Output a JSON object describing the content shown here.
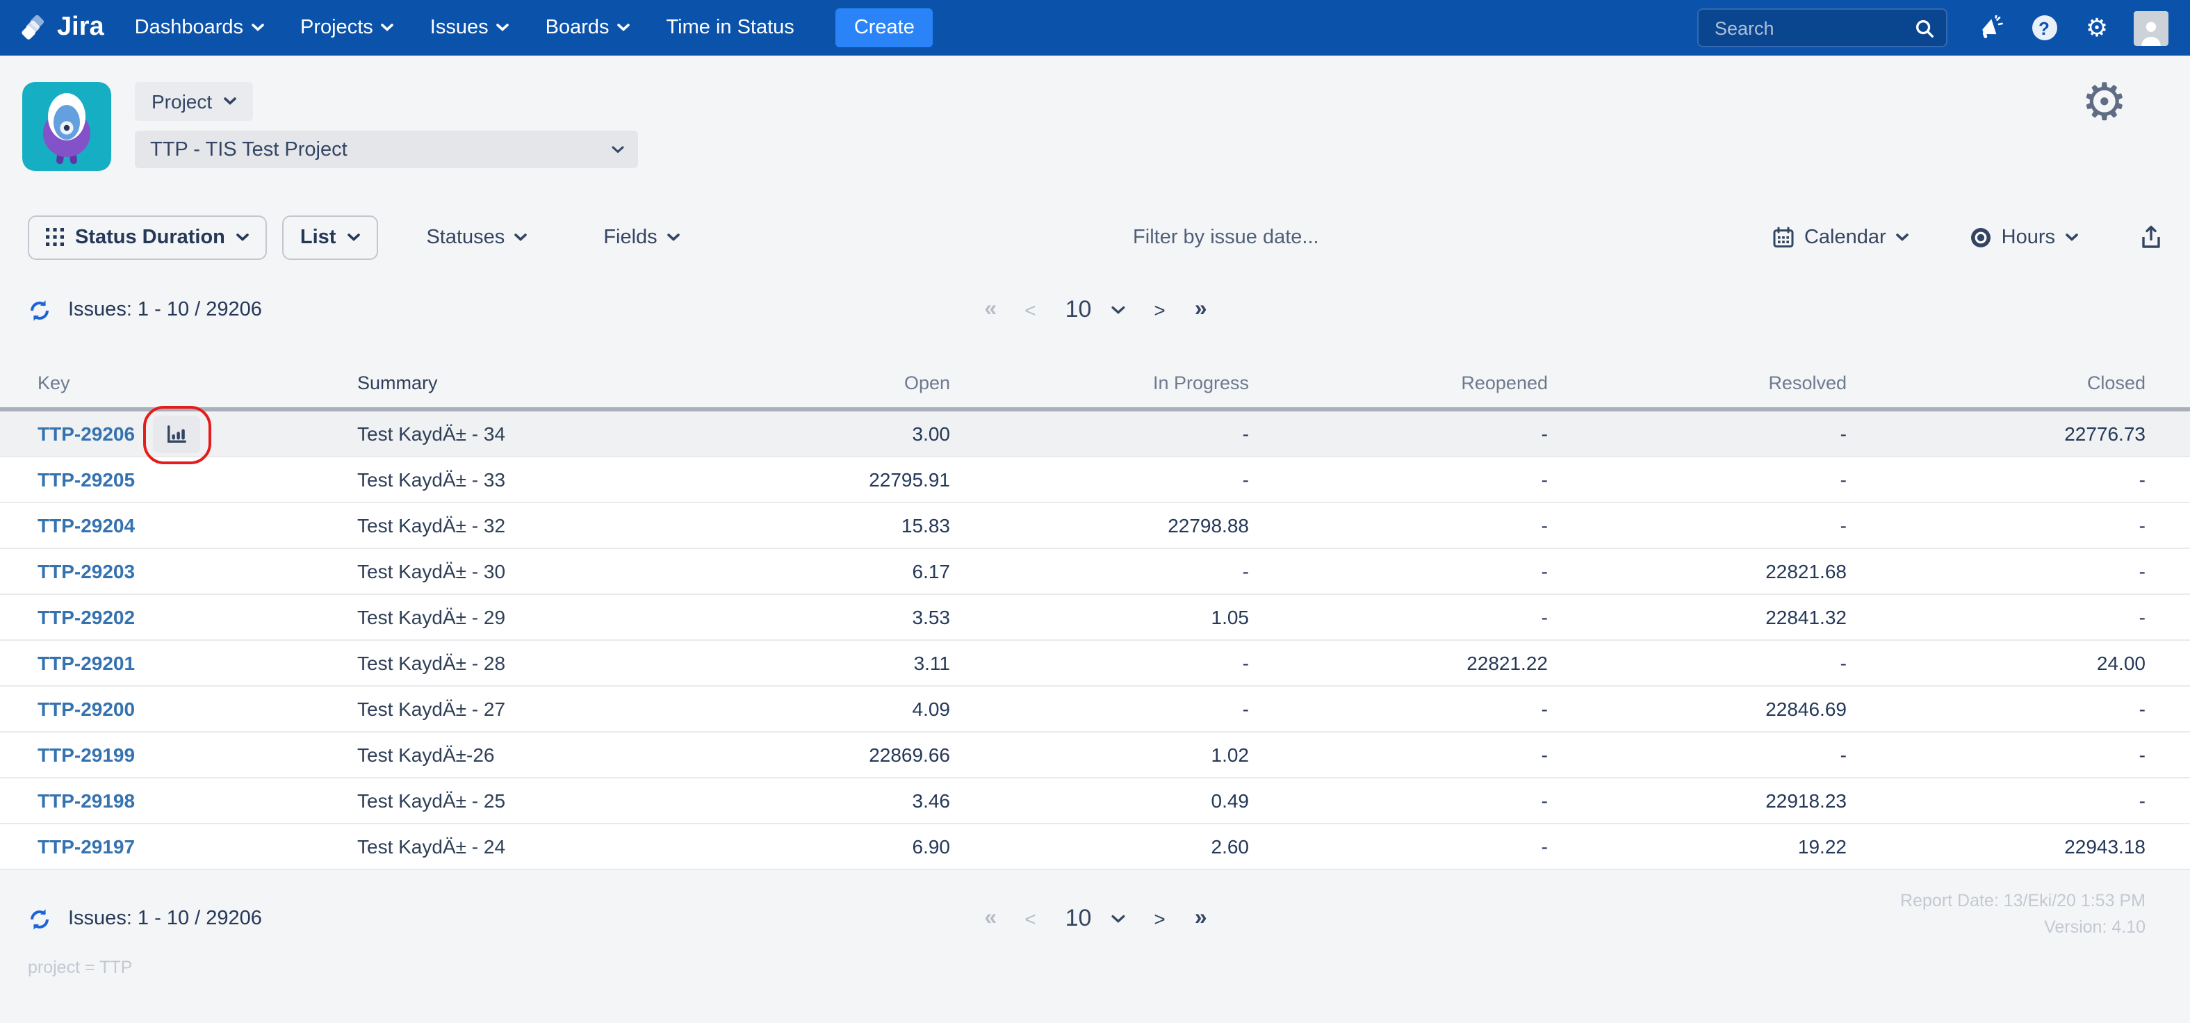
{
  "nav": {
    "brand": "Jira",
    "items": [
      {
        "label": "Dashboards"
      },
      {
        "label": "Projects"
      },
      {
        "label": "Issues"
      },
      {
        "label": "Boards"
      },
      {
        "label": "Time in Status"
      }
    ],
    "create_label": "Create",
    "search_placeholder": "Search"
  },
  "project_header": {
    "scope_label": "Project",
    "selected_project": "TTP - TIS Test Project"
  },
  "toolbar": {
    "report_type": "Status Duration",
    "view_mode": "List",
    "statuses_label": "Statuses",
    "fields_label": "Fields",
    "date_filter_placeholder": "Filter by issue date...",
    "calendar_label": "Calendar",
    "unit_label": "Hours"
  },
  "pagination": {
    "issues_label": "Issues: 1 - 10 / 29206",
    "first": "«",
    "prev": "<",
    "page_size": "10",
    "next": ">",
    "last": "»"
  },
  "table": {
    "columns": {
      "key": "Key",
      "summary": "Summary",
      "open": "Open",
      "in_progress": "In Progress",
      "reopened": "Reopened",
      "resolved": "Resolved",
      "closed": "Closed"
    },
    "rows": [
      {
        "key": "TTP-29206",
        "summary": "Test KaydÄ± - 34",
        "open": "3.00",
        "in_progress": "-",
        "reopened": "-",
        "resolved": "-",
        "closed": "22776.73",
        "highlighted": true,
        "chart_button": true
      },
      {
        "key": "TTP-29205",
        "summary": "Test KaydÄ± - 33",
        "open": "22795.91",
        "in_progress": "-",
        "reopened": "-",
        "resolved": "-",
        "closed": "-"
      },
      {
        "key": "TTP-29204",
        "summary": "Test KaydÄ± - 32",
        "open": "15.83",
        "in_progress": "22798.88",
        "reopened": "-",
        "resolved": "-",
        "closed": "-"
      },
      {
        "key": "TTP-29203",
        "summary": "Test KaydÄ± - 30",
        "open": "6.17",
        "in_progress": "-",
        "reopened": "-",
        "resolved": "22821.68",
        "closed": "-"
      },
      {
        "key": "TTP-29202",
        "summary": "Test KaydÄ± - 29",
        "open": "3.53",
        "in_progress": "1.05",
        "reopened": "-",
        "resolved": "22841.32",
        "closed": "-"
      },
      {
        "key": "TTP-29201",
        "summary": "Test KaydÄ± - 28",
        "open": "3.11",
        "in_progress": "-",
        "reopened": "22821.22",
        "resolved": "-",
        "closed": "24.00"
      },
      {
        "key": "TTP-29200",
        "summary": "Test KaydÄ± - 27",
        "open": "4.09",
        "in_progress": "-",
        "reopened": "-",
        "resolved": "22846.69",
        "closed": "-"
      },
      {
        "key": "TTP-29199",
        "summary": "Test KaydÄ±-26",
        "open": "22869.66",
        "in_progress": "1.02",
        "reopened": "-",
        "resolved": "-",
        "closed": "-"
      },
      {
        "key": "TTP-29198",
        "summary": "Test KaydÄ± - 25",
        "open": "3.46",
        "in_progress": "0.49",
        "reopened": "-",
        "resolved": "22918.23",
        "closed": "-"
      },
      {
        "key": "TTP-29197",
        "summary": "Test KaydÄ± - 24",
        "open": "6.90",
        "in_progress": "2.60",
        "reopened": "-",
        "resolved": "19.22",
        "closed": "22943.18"
      }
    ]
  },
  "footer": {
    "report_date": "Report Date: 13/Eki/20 1:53 PM",
    "version": "Version: 4.10",
    "jql": "project = TTP"
  },
  "colors": {
    "nav_blue": "#0b52ab",
    "create_blue": "#2a84f8",
    "link_blue": "#3572b0",
    "annotation_red": "#e51c1c",
    "project_avatar_teal": "#16aec2",
    "page_bg": "#f4f5f7",
    "muted_gray": "#c3c9d2"
  }
}
